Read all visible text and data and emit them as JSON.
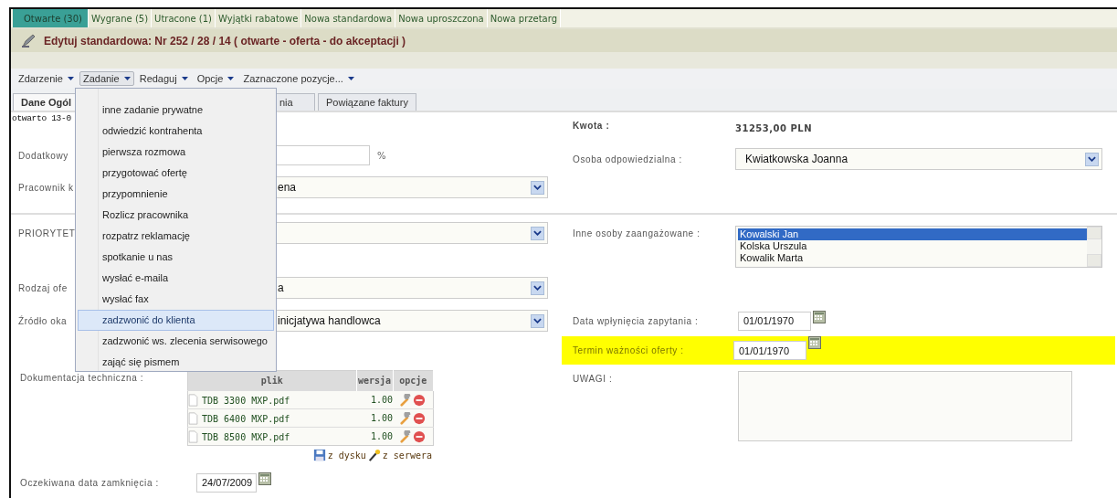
{
  "nav_tabs": [
    {
      "label": "Otwarte (30)",
      "selected": true
    },
    {
      "label": "Wygrane (5)",
      "selected": false
    },
    {
      "label": "Utracone (1)",
      "selected": false
    },
    {
      "label": "Wyjątki rabatowe",
      "selected": false
    },
    {
      "label": "Nowa standardowa",
      "selected": false
    },
    {
      "label": "Nowa uproszczona",
      "selected": false
    },
    {
      "label": "Nowa przetarg",
      "selected": false
    }
  ],
  "title": "Edytuj standardowa: Nr 252 / 28 / 14 ( otwarte - oferta - do akceptacji )",
  "menu": [
    {
      "label": "Zdarzenie",
      "selected": false
    },
    {
      "label": "Zadanie",
      "selected": true
    },
    {
      "label": "Redaguj",
      "selected": false
    },
    {
      "label": "Opcje",
      "selected": false
    },
    {
      "label": "Zaznaczone pozycje...",
      "selected": false
    }
  ],
  "dropdown": [
    {
      "label": "inne zadanie prywatne",
      "selected": false
    },
    {
      "label": "odwiedzić kontrahenta",
      "selected": false
    },
    {
      "label": "pierwsza rozmowa",
      "selected": false
    },
    {
      "label": "przygotować ofertę",
      "selected": false
    },
    {
      "label": "przypomnienie",
      "selected": false
    },
    {
      "label": "Rozlicz pracownika",
      "selected": false
    },
    {
      "label": "rozpatrz reklamację",
      "selected": false
    },
    {
      "label": "spotkanie u nas",
      "selected": false
    },
    {
      "label": "wysłać e-maila",
      "selected": false
    },
    {
      "label": "wysłać fax",
      "selected": false
    },
    {
      "label": "zadzwonić do klienta",
      "selected": true
    },
    {
      "label": "zadzwonić ws. zlecenia serwisowego",
      "selected": false
    },
    {
      "label": "zająć się pismem",
      "selected": false
    }
  ],
  "tabs": [
    {
      "label": "Dane Ogól",
      "selected": true
    },
    {
      "label": "nia",
      "selected": false
    },
    {
      "label": "Powiązane faktury",
      "selected": false
    }
  ],
  "opened": "otwarto 13-0",
  "amount": {
    "label": "Kwota :",
    "value": "31253,00 PLN"
  },
  "discount": {
    "label": "Dodatkowy",
    "unit": "%"
  },
  "employee": {
    "label": "Pracownik k",
    "value": "ena"
  },
  "responsible": {
    "label": "Osoba odpowiedzialna :",
    "value": "Kwiatkowska Joanna"
  },
  "priority": {
    "label": "PRIORYTET"
  },
  "others": {
    "label": "Inne osoby zaangażowane :",
    "options": [
      {
        "label": "Kowalski Jan",
        "selected": true
      },
      {
        "label": "Kolska Urszula",
        "selected": false
      },
      {
        "label": "Kowalik Marta",
        "selected": false
      }
    ]
  },
  "offer_type": {
    "label": "Rodzaj ofe",
    "value": "a"
  },
  "source": {
    "label": "Źródło oka",
    "value": "inicjatywa handlowca"
  },
  "inquiry_date": {
    "label": "Data wpłynięcia zapytania :",
    "value": "01/01/1970"
  },
  "validity": {
    "label": "Termin ważności oferty :",
    "value": "01/01/1970",
    "highlighted": true
  },
  "notes": {
    "label": "UWAGI :"
  },
  "docs": {
    "label": "Dokumentacja techniczna :",
    "columns": [
      "plik",
      "wersja",
      "opcje"
    ],
    "rows": [
      {
        "file": "TDB 3300 MXP.pdf",
        "version": "1.00"
      },
      {
        "file": "TDB 6400 MXP.pdf",
        "version": "1.00"
      },
      {
        "file": "TDB 8500 MXP.pdf",
        "version": "1.00"
      }
    ],
    "from_disk": "z dysku",
    "from_server": "z serwera"
  },
  "close_date": {
    "label": "Oczekiwana data zamknięcia :",
    "value": "24/07/2009"
  }
}
